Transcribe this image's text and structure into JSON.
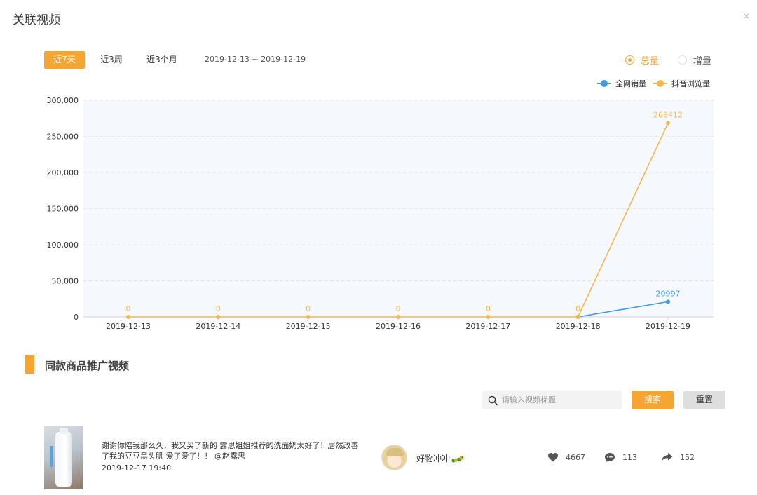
{
  "dialog": {
    "title": "关联视频",
    "close_label": "×"
  },
  "range_tabs": [
    {
      "label": "近7天",
      "active": true
    },
    {
      "label": "近3周",
      "active": false
    },
    {
      "label": "近3个月",
      "active": false
    }
  ],
  "date_range": "2019-12-13 ~ 2019-12-19",
  "mode_radios": [
    {
      "label": "总量",
      "checked": true
    },
    {
      "label": "增量",
      "checked": false
    }
  ],
  "colors": {
    "accent": "#f5a534",
    "sales": "#3d9be8",
    "views": "#f5b74c",
    "plot_bg": "#f5f9fe"
  },
  "chart_data": {
    "type": "line",
    "categories": [
      "2019-12-13",
      "2019-12-14",
      "2019-12-15",
      "2019-12-16",
      "2019-12-17",
      "2019-12-18",
      "2019-12-19"
    ],
    "series": [
      {
        "name": "全网销量",
        "color": "#3d9be8",
        "values": [
          null,
          null,
          null,
          null,
          null,
          0,
          20997
        ],
        "labels": [
          null,
          null,
          null,
          null,
          null,
          null,
          "20997"
        ]
      },
      {
        "name": "抖音浏览量",
        "color": "#f5b74c",
        "values": [
          0,
          0,
          0,
          0,
          0,
          0,
          268412
        ],
        "labels": [
          "0",
          "0",
          "0",
          "0",
          "0",
          "0",
          "268412"
        ]
      }
    ],
    "ylim": [
      0,
      300000
    ],
    "yticks": [
      0,
      50000,
      100000,
      150000,
      200000,
      250000,
      300000
    ],
    "ytick_labels": [
      "0",
      "50,000",
      "100,000",
      "150,000",
      "200,000",
      "250,000",
      "300,000"
    ],
    "grid": true,
    "legend": "top-right"
  },
  "section": {
    "title": "同款商品推广视频"
  },
  "search": {
    "placeholder": "请输入视频标题",
    "value": "",
    "search_label": "搜索",
    "reset_label": "重置"
  },
  "videos": [
    {
      "description": "谢谢你陪我那么久，我又买了新的 露思姐姐推荐的洗面奶太好了！居然改善了我的豆豆黑头肌 爱了爱了！！ @赵露思",
      "time": "2019-12-17 19:40",
      "author": "好物冲冲",
      "likes": "4667",
      "comments": "113",
      "shares": "152"
    }
  ]
}
